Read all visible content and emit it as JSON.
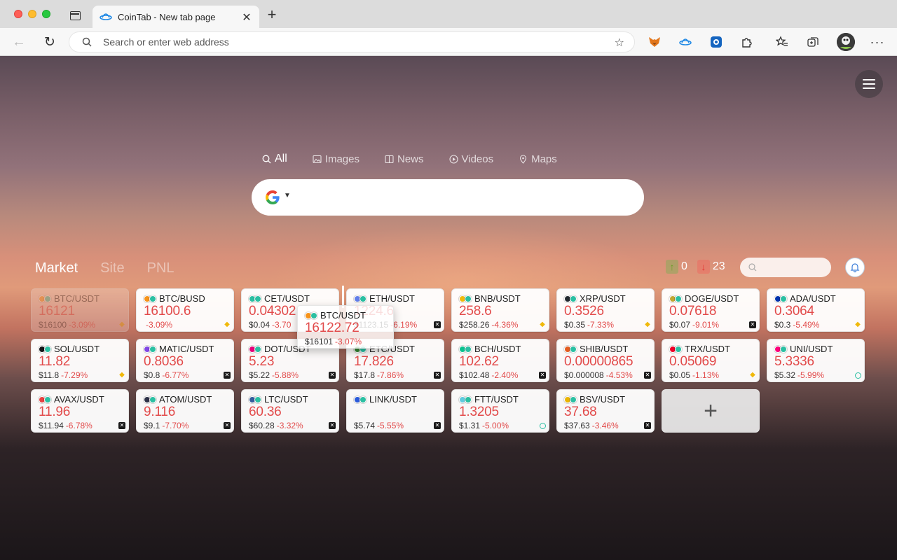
{
  "browser": {
    "tab_title": "CoinTab - New tab page",
    "tab_close": "✕",
    "new_tab": "+",
    "address_placeholder": "Search or enter web address"
  },
  "search": {
    "tabs": [
      {
        "label": "All",
        "active": true,
        "icon": "search-icon"
      },
      {
        "label": "Images",
        "active": false,
        "icon": "image-icon"
      },
      {
        "label": "News",
        "active": false,
        "icon": "news-icon"
      },
      {
        "label": "Videos",
        "active": false,
        "icon": "play-icon"
      },
      {
        "label": "Maps",
        "active": false,
        "icon": "map-pin-icon"
      }
    ],
    "engine": "google-icon"
  },
  "market": {
    "tabs": [
      "Market",
      "Site",
      "PNL"
    ],
    "up_count": "0",
    "down_count": "23",
    "colors": {
      "up": "#6c9f2a",
      "down": "#e24b4b"
    },
    "cards": [
      {
        "pair": "BTC/USDT",
        "price": "16121",
        "usd": "$16100",
        "change": "-3.09%",
        "exchange": "binance",
        "ghost": true,
        "coin": "#f7931a"
      },
      {
        "pair": "BTC/BUSD",
        "price": "16100.6",
        "usd": "",
        "change": "-3.09%",
        "exchange": "binance",
        "coin": "#f7931a"
      },
      {
        "pair": "CET/USDT",
        "price": "0.04302",
        "usd": "$0.04",
        "change": "-3.70",
        "exchange": "",
        "coin": "#2bbfa2"
      },
      {
        "pair": "ETH/USDT",
        "price": "1224.6",
        "usd": "$1123.15",
        "change": "-6.19%",
        "exchange": "ftx",
        "coin": "#627eea"
      },
      {
        "pair": "BNB/USDT",
        "price": "258.6",
        "usd": "$258.26",
        "change": "-4.36%",
        "exchange": "binance",
        "coin": "#f0b90b"
      },
      {
        "pair": "XRP/USDT",
        "price": "0.3526",
        "usd": "$0.35",
        "change": "-7.33%",
        "exchange": "binance",
        "coin": "#23292f"
      },
      {
        "pair": "DOGE/USDT",
        "price": "0.07618",
        "usd": "$0.07",
        "change": "-9.01%",
        "exchange": "ftx",
        "coin": "#c2a633"
      },
      {
        "pair": "ADA/USDT",
        "price": "0.3064",
        "usd": "$0.3",
        "change": "-5.49%",
        "exchange": "binance",
        "coin": "#0033ad"
      },
      {
        "pair": "SOL/USDT",
        "price": "11.82",
        "usd": "$11.8",
        "change": "-7.29%",
        "exchange": "binance",
        "coin": "#14161a"
      },
      {
        "pair": "MATIC/USDT",
        "price": "0.8036",
        "usd": "$0.8",
        "change": "-6.77%",
        "exchange": "ftx",
        "coin": "#8247e5"
      },
      {
        "pair": "DOT/USDT",
        "price": "5.23",
        "usd": "$5.22",
        "change": "-5.88%",
        "exchange": "ftx",
        "coin": "#e6007a"
      },
      {
        "pair": "ETC/USDT",
        "price": "17.826",
        "usd": "$17.8",
        "change": "-7.86%",
        "exchange": "ftx",
        "coin": "#328332"
      },
      {
        "pair": "BCH/USDT",
        "price": "102.62",
        "usd": "$102.48",
        "change": "-2.40%",
        "exchange": "ftx",
        "coin": "#0ac18e"
      },
      {
        "pair": "SHIB/USDT",
        "price": "0.00000865",
        "usd": "$0.000008",
        "change": "-4.53%",
        "exchange": "ftx",
        "coin": "#e45b1e"
      },
      {
        "pair": "TRX/USDT",
        "price": "0.05069",
        "usd": "$0.05",
        "change": "-1.13%",
        "exchange": "binance",
        "coin": "#ef0027"
      },
      {
        "pair": "UNI/USDT",
        "price": "5.3336",
        "usd": "$5.32",
        "change": "-5.99%",
        "exchange": "coinex",
        "coin": "#ff007a"
      },
      {
        "pair": "AVAX/USDT",
        "price": "11.96",
        "usd": "$11.94",
        "change": "-6.78%",
        "exchange": "ftx",
        "coin": "#e84142"
      },
      {
        "pair": "ATOM/USDT",
        "price": "9.116",
        "usd": "$9.1",
        "change": "-7.70%",
        "exchange": "ftx",
        "coin": "#2e3148"
      },
      {
        "pair": "LTC/USDT",
        "price": "60.36",
        "usd": "$60.28",
        "change": "-3.32%",
        "exchange": "ftx",
        "coin": "#345d9d"
      },
      {
        "pair": "LINK/USDT",
        "price": "",
        "usd": "$5.74",
        "change": "-5.55%",
        "exchange": "ftx",
        "coin": "#2a5ada"
      },
      {
        "pair": "FTT/USDT",
        "price": "1.3205",
        "usd": "$1.31",
        "change": "-5.00%",
        "exchange": "coinex",
        "coin": "#5fcade"
      },
      {
        "pair": "BSV/USDT",
        "price": "37.68",
        "usd": "$37.63",
        "change": "-3.46%",
        "exchange": "ftx",
        "coin": "#eab300"
      }
    ],
    "dragging": {
      "pair": "BTC/USDT",
      "price": "16122.72",
      "usd": "$16101",
      "change": "-3.07%",
      "coin": "#f7931a"
    },
    "add_label": "+"
  }
}
